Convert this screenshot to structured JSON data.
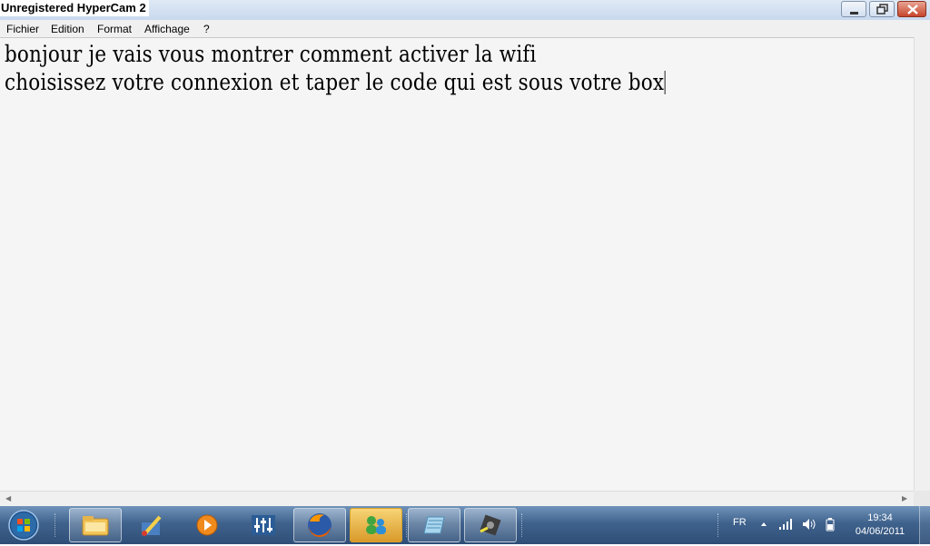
{
  "window": {
    "watermark": "Unregistered HyperCam 2",
    "buttons": [
      "minimize",
      "maximize",
      "close"
    ]
  },
  "menu": [
    "Fichier",
    "Edition",
    "Format",
    "Affichage",
    "?"
  ],
  "document": {
    "lines": [
      "bonjour je vais vous montrer comment activer la wifi",
      "choisissez votre connexion et taper le code qui est sous votre box"
    ]
  },
  "taskbar": {
    "apps": [
      "explorer-icon",
      "paint-icon",
      "media-player-icon",
      "mixer-icon",
      "firefox-icon",
      "messenger-icon",
      "notepad-icon",
      "hypercam-icon"
    ],
    "language": "FR",
    "time": "19:34",
    "date": "04/06/2011"
  }
}
